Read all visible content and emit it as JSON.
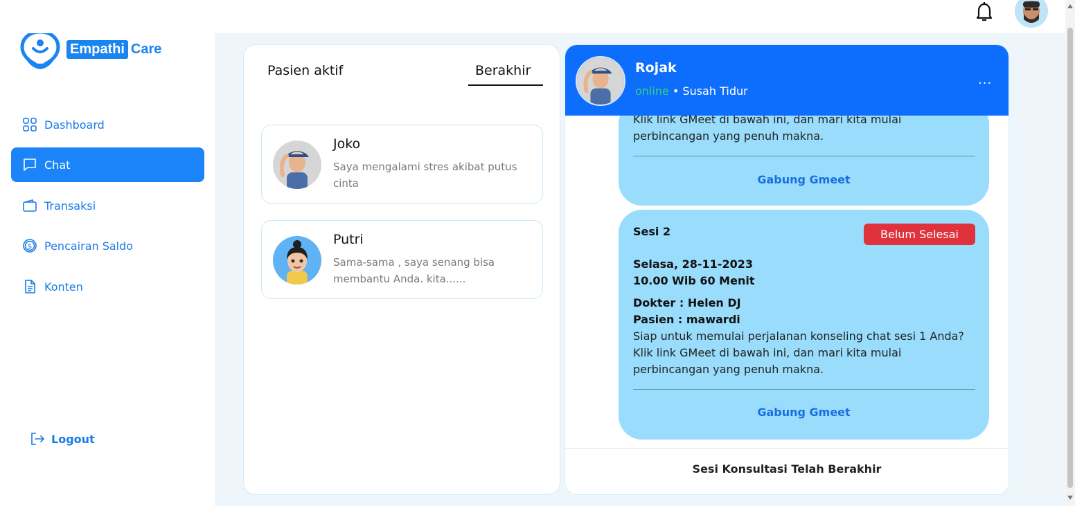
{
  "brand": {
    "name_part1": "Empathi",
    "name_part2": "Care",
    "color": "#1a84f0"
  },
  "sidebar": {
    "items": [
      {
        "label": "Dashboard",
        "icon": "grid-icon"
      },
      {
        "label": "Chat",
        "icon": "chat-icon",
        "active": true
      },
      {
        "label": "Transaksi",
        "icon": "wallet-icon"
      },
      {
        "label": "Pencairan Saldo",
        "icon": "dollar-circle-icon"
      },
      {
        "label": "Konten",
        "icon": "document-icon"
      }
    ],
    "logout_label": "Logout"
  },
  "tabs": {
    "active_patients": "Pasien aktif",
    "ended": "Berakhir",
    "selected": "Berakhir"
  },
  "patients": [
    {
      "name": "Joko",
      "message": "Saya mengalami stres akibat putus cinta"
    },
    {
      "name": "Putri",
      "message": "Sama-sama , saya senang bisa membantu Anda. kita......"
    }
  ],
  "chat": {
    "name": "Rojak",
    "status": "online",
    "separator": " • ",
    "topic": "Susah Tidur",
    "menu": "...",
    "session1": {
      "text_partial": "Klik link GMeet di bawah ini, dan mari kita mulai perbincangan yang penuh makna.",
      "join_label": "Gabung Gmeet"
    },
    "session2": {
      "title": "Sesi 2",
      "badge": "Belum Selesai",
      "date": "Selasa, 28-11-2023",
      "time": "10.00 Wib 60 Menit",
      "doctor": "Dokter : Helen DJ",
      "patient": "Pasien : mawardi",
      "text": "Siap untuk memulai perjalanan konseling chat sesi 1 Anda? Klik link GMeet di bawah ini, dan mari kita mulai perbincangan yang penuh makna.",
      "join_label": "Gabung Gmeet"
    },
    "footer": "Sesi Konsultasi Telah Berakhir"
  },
  "colors": {
    "primary": "#0d6efd",
    "bubble": "#99dcfc",
    "badge_red": "#e0323c",
    "online_green": "#2fd47a"
  }
}
